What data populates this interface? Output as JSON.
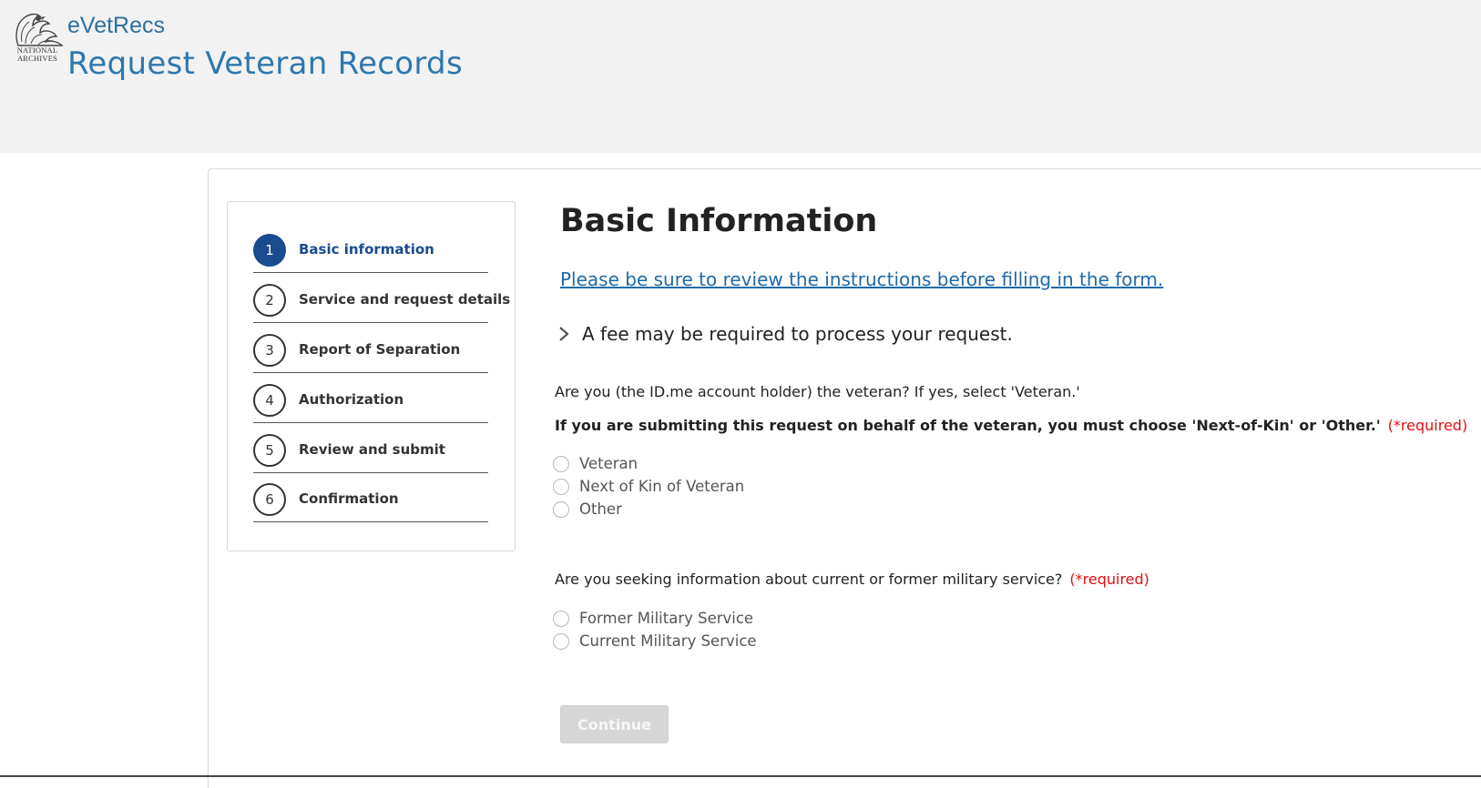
{
  "header": {
    "logo_text": "NATIONAL ARCHIVES",
    "app_name": "eVetRecs",
    "page_heading": "Request Veteran Records",
    "background": "#f2f2f2",
    "accent": "#2e78ad"
  },
  "stepper": {
    "steps": [
      {
        "number": "1",
        "label": "Basic information",
        "active": true
      },
      {
        "number": "2",
        "label": "Service and request details",
        "active": false
      },
      {
        "number": "3",
        "label": "Report of Separation",
        "active": false
      },
      {
        "number": "4",
        "label": "Authorization",
        "active": false
      },
      {
        "number": "5",
        "label": "Review and submit",
        "active": false
      },
      {
        "number": "6",
        "label": "Confirmation",
        "active": false
      }
    ],
    "active_color": "#1b4b8f"
  },
  "main": {
    "title": "Basic Information",
    "instructions_link": "Please be sure to review the instructions before filling in the form.",
    "fee_notice": "A fee may be required to process your request.",
    "question1": {
      "line1": "Are you (the ID.me account holder) the veteran? If yes, select 'Veteran.'",
      "line2": "If you are submitting this request on behalf of the veteran, you must choose 'Next-of-Kin' or 'Other.'",
      "required": "(*required)",
      "options": [
        "Veteran",
        "Next of Kin of Veteran",
        "Other"
      ]
    },
    "question2": {
      "text": "Are you seeking information about current or former military service?",
      "required": "(*required)",
      "options": [
        "Former Military Service",
        "Current Military Service"
      ]
    },
    "continue_label": "Continue",
    "required_color": "#e01010"
  }
}
